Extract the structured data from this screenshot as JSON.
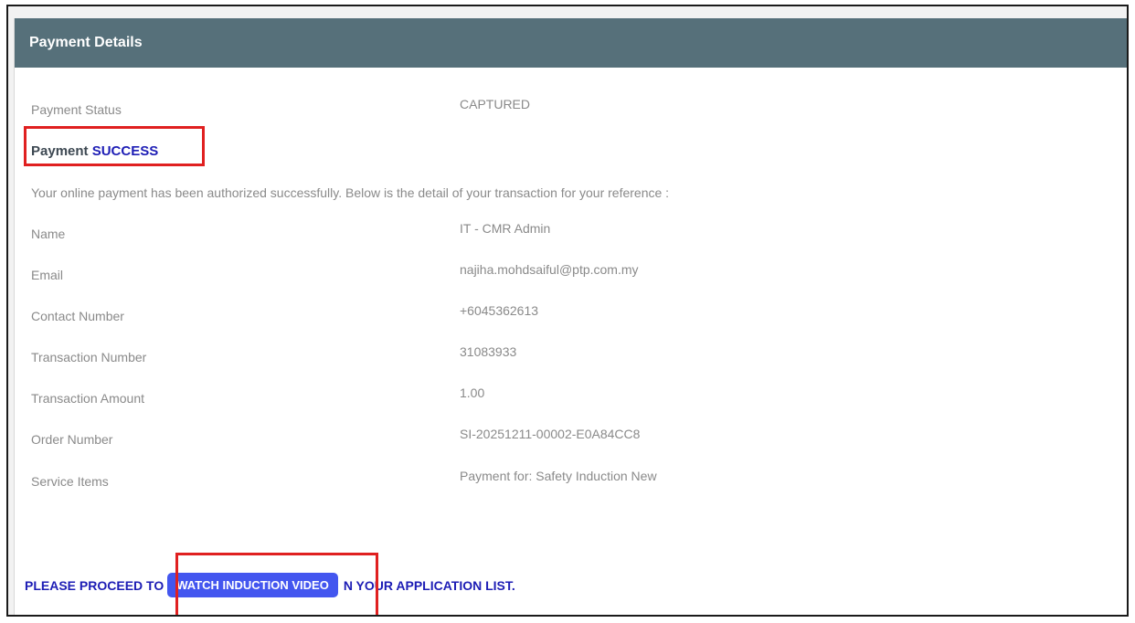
{
  "panel": {
    "title": "Payment Details"
  },
  "status": {
    "label": "Payment Status",
    "value": "CAPTURED"
  },
  "success": {
    "prefix": "Payment",
    "word": "SUCCESS"
  },
  "intro_text": "Your online payment has been authorized successfully. Below is the detail of your transaction for your reference :",
  "details": [
    {
      "label": "Name",
      "value": "IT - CMR Admin"
    },
    {
      "label": "Email",
      "value": "najiha.mohdsaiful@ptp.com.my"
    },
    {
      "label": "Contact Number",
      "value": "+6045362613"
    },
    {
      "label": "Transaction Number",
      "value": "31083933"
    },
    {
      "label": "Transaction Amount",
      "value": "1.00"
    },
    {
      "label": "Order Number",
      "value": "SI-20251211-00002-E0A84CC8"
    },
    {
      "label": "Service Items",
      "value": "Payment for: Safety Induction New"
    }
  ],
  "proceed": {
    "before": "PLEASE PROCEED TO",
    "button": "WATCH INDUCTION VIDEO",
    "after": "N YOUR APPLICATION LIST."
  },
  "colors": {
    "header_bg": "#56707a",
    "success_blue": "#1d1db5",
    "button_bg": "#4356ef",
    "highlight_red": "#e02020"
  }
}
